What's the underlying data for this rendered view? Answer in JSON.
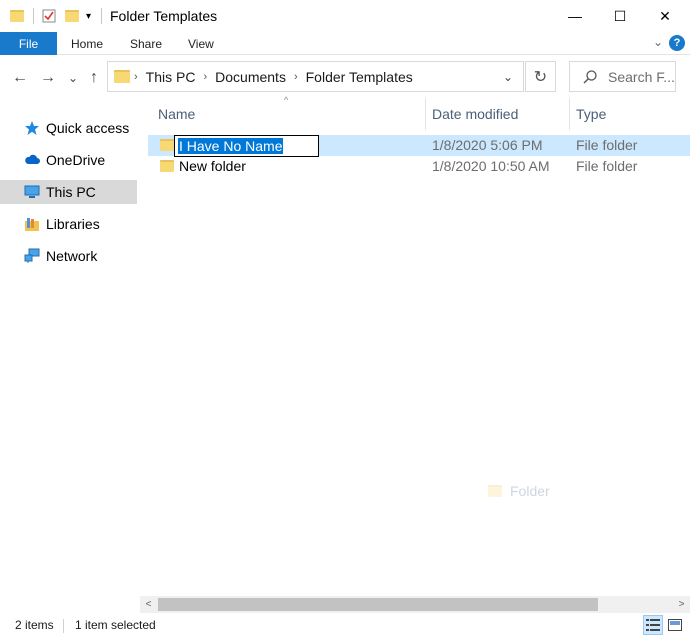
{
  "window": {
    "title": "Folder Templates",
    "minimize_glyph": "—",
    "maximize_glyph": "☐",
    "close_glyph": "✕"
  },
  "ribbon": {
    "file": "File",
    "tabs": [
      "Home",
      "Share",
      "View"
    ],
    "help": "?",
    "collapse_glyph": "⌄"
  },
  "nav": {
    "back_glyph": "←",
    "forward_glyph": "→",
    "recent_glyph": "⌄",
    "up_glyph": "↑"
  },
  "address": {
    "crumbs": [
      "This PC",
      "Documents",
      "Folder Templates"
    ],
    "sep_glyph": "›",
    "dropdown_glyph": "⌄",
    "refresh_glyph": "↻"
  },
  "search": {
    "placeholder": "Search F..."
  },
  "navpane": {
    "items": [
      {
        "label": "Quick access",
        "icon": "star-icon"
      },
      {
        "label": "OneDrive",
        "icon": "cloud-icon"
      },
      {
        "label": "This PC",
        "icon": "computer-icon",
        "selected": true
      },
      {
        "label": "Libraries",
        "icon": "library-icon"
      },
      {
        "label": "Network",
        "icon": "network-icon"
      }
    ]
  },
  "columns": {
    "name": "Name",
    "date": "Date modified",
    "type": "Type",
    "sort_glyph": "^"
  },
  "files": [
    {
      "name": "I Have No Name",
      "date": "1/8/2020 5:06 PM",
      "type": "File folder",
      "selected": true,
      "renaming": true
    },
    {
      "name": "New folder",
      "date": "1/8/2020 10:50 AM",
      "type": "File folder"
    }
  ],
  "drag_ghost": {
    "label": "Folder"
  },
  "scroll": {
    "left_glyph": "<",
    "right_glyph": ">"
  },
  "status": {
    "items": "2 items",
    "selected": "1 item selected"
  },
  "colors": {
    "accent": "#1979ca",
    "selection": "#cce8ff",
    "folder": "#f8d775"
  }
}
